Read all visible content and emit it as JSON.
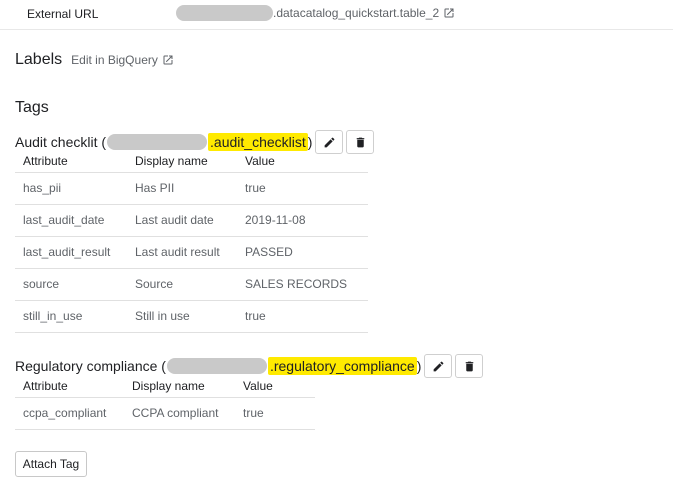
{
  "external_url": {
    "label": "External URL",
    "value": ".datacatalog_quickstart.table_2",
    "icon": "open-in-new-icon"
  },
  "labels": {
    "title": "Labels",
    "edit_link": "Edit in BigQuery",
    "icon": "open-in-new-icon"
  },
  "tags": {
    "title": "Tags",
    "items": [
      {
        "name": "Audit checklit",
        "open_paren": "(",
        "template_id": ".audit_checklist",
        "close_paren": ")",
        "columns": [
          "Attribute",
          "Display name",
          "Value"
        ],
        "rows": [
          [
            "has_pii",
            "Has PII",
            "true"
          ],
          [
            "last_audit_date",
            "Last audit date",
            "2019-11-08"
          ],
          [
            "last_audit_result",
            "Last audit result",
            "PASSED"
          ],
          [
            "source",
            "Source",
            "SALES RECORDS"
          ],
          [
            "still_in_use",
            "Still in use",
            "true"
          ]
        ]
      },
      {
        "name": "Regulatory compliance",
        "open_paren": "(",
        "template_id": ".regulatory_compliance",
        "close_paren": ")",
        "columns": [
          "Attribute",
          "Display name",
          "Value"
        ],
        "rows": [
          [
            "ccpa_compliant",
            "CCPA compliant",
            "true"
          ]
        ]
      }
    ]
  },
  "attach_button": "Attach Tag",
  "colors": {
    "highlight": "#ffea00",
    "redaction": "#c9c9c9"
  }
}
